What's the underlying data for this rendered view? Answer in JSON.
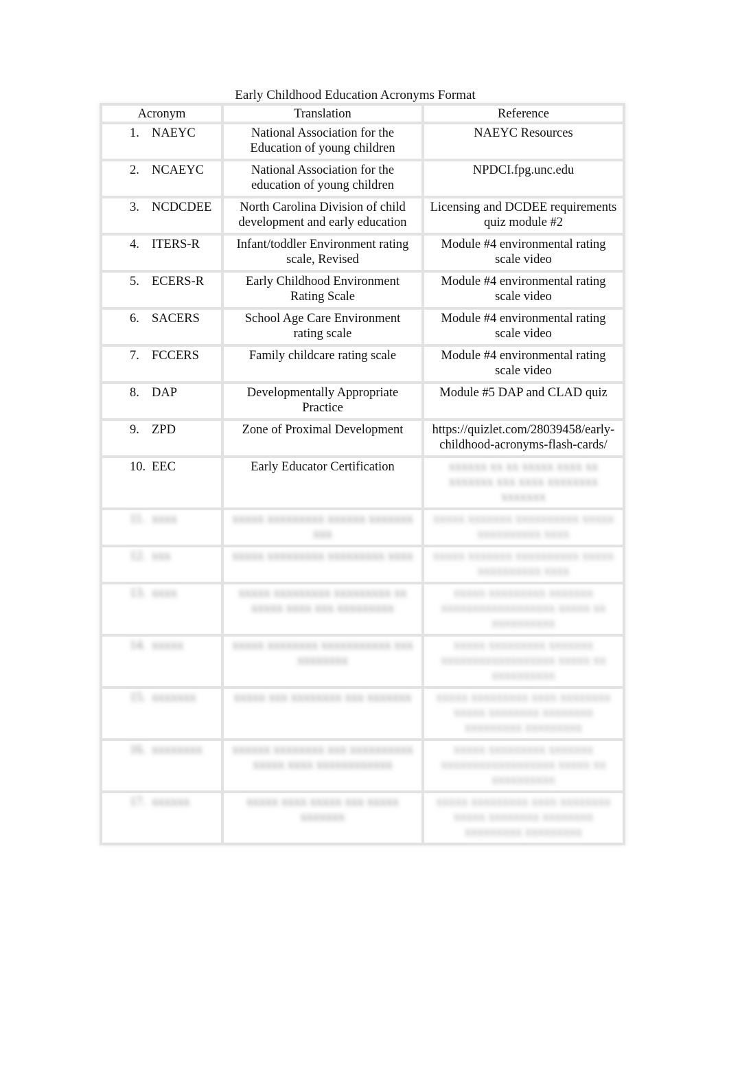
{
  "document": {
    "title": "Early Childhood Education Acronyms Format",
    "headers": [
      "Acronym",
      "Translation",
      "Reference"
    ],
    "rows": [
      {
        "num": "1.",
        "acronym": "NAEYC",
        "translation": "National Association for the Education of young children",
        "reference": "NAEYC Resources"
      },
      {
        "num": "2.",
        "acronym": "NCAEYC",
        "translation": "National Association for the education of young children",
        "reference": "NPDCI.fpg.unc.edu"
      },
      {
        "num": "3.",
        "acronym": "NCDCDEE",
        "translation": "North Carolina Division of child development and early education",
        "reference": "Licensing and DCDEE requirements quiz module #2"
      },
      {
        "num": "4.",
        "acronym": "ITERS-R",
        "translation": "Infant/toddler Environment rating scale, Revised",
        "reference": "Module #4 environmental rating scale video"
      },
      {
        "num": "5.",
        "acronym": "ECERS-R",
        "translation": "Early Childhood Environment Rating Scale",
        "reference": "Module #4 environmental rating scale video"
      },
      {
        "num": "6.",
        "acronym": "SACERS",
        "translation": "School Age Care Environment rating scale",
        "reference": "Module #4 environmental rating scale video"
      },
      {
        "num": "7.",
        "acronym": "FCCERS",
        "translation": "Family childcare rating scale",
        "reference": "Module #4 environmental rating scale video"
      },
      {
        "num": "8.",
        "acronym": "DAP",
        "translation": "Developmentally Appropriate Practice",
        "reference": "Module #5 DAP and CLAD quiz"
      },
      {
        "num": "9.",
        "acronym": "ZPD",
        "translation": "Zone of Proximal Development",
        "reference": "https://quizlet.com/28039458/early-childhood-acronyms-flash-cards/"
      },
      {
        "num": "10.",
        "acronym": "EEC",
        "translation": "Early Educator Certification",
        "reference": "xxxxxx xx xx xxxxx xxxx xx xxxxxxx xxx xxxx xxxxxxxx xxxxxxx"
      }
    ],
    "blurred_rows": [
      {
        "num": "11.",
        "acronym": "xxxx",
        "translation": "xxxxx xxxxxxxxx xxxxxx xxxxxxx xxx",
        "reference": "xxxxx xxxxxxx xxxxxxxxxx xxxxx xxxxxxxxxx xxxx"
      },
      {
        "num": "12.",
        "acronym": "xxx",
        "translation": "xxxxx xxxxxxxxx xxxxxxxxx xxxx",
        "reference": "xxxxx xxxxxxx xxxxxxxxxx xxxxx xxxxxxxxxx xxxx"
      },
      {
        "num": "13.",
        "acronym": "xxxx",
        "translation": "xxxxx xxxxxxxxx xxxxxxxxx xx xxxxx xxxx xxx xxxxxxxxx",
        "reference": "xxxxx xxxxxxxxx xxxxxxx xxxxxxxxxxxxxxxxxx xxxxx xx xxxxxxxxxx"
      },
      {
        "num": "14.",
        "acronym": "xxxxx",
        "translation": "xxxxx xxxxxxxx xxxxxxxxxxx xxx xxxxxxxx",
        "reference": "xxxxx xxxxxxxxx xxxxxxx xxxxxxxxxxxxxxxxxx xxxxx xx xxxxxxxxxx"
      },
      {
        "num": "15.",
        "acronym": "xxxxxxx",
        "translation": "xxxxx xxx xxxxxxxx xxx xxxxxxx",
        "reference": "xxxxx xxxxxxxxx xxxx xxxxxxxx xxxxx xxxxxxxx xxxxxxxx xxxxxxxxx xxxxxxxxx"
      },
      {
        "num": "16.",
        "acronym": "xxxxxxxx",
        "translation": "xxxxxx xxxxxxxx xxx xxxxxxxxxx xxxxx xxxx xxxxxxxxxxxx",
        "reference": "xxxxx xxxxxxxxx xxxxxxx xxxxxxxxxxxxxxxxxx xxxxx xx xxxxxxxxxx"
      },
      {
        "num": "17.",
        "acronym": "xxxxxx",
        "translation": "xxxxx xxxx xxxxx xxx xxxxx xxxxxxx",
        "reference": "xxxxx xxxxxxxxx xxxx xxxxxxxx xxxxx xxxxxxxx xxxxxxxx xxxxxxxxx xxxxxxxxx"
      }
    ]
  }
}
